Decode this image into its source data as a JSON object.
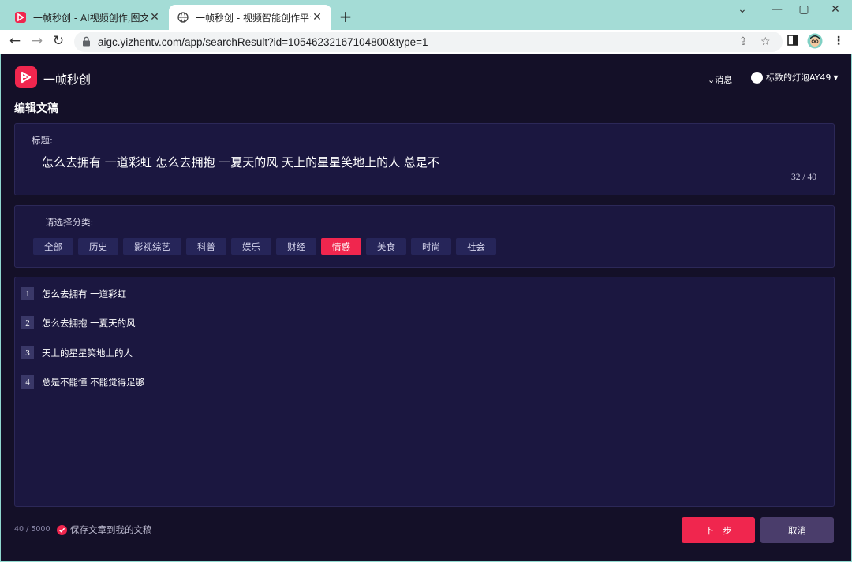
{
  "browser": {
    "tabs": [
      {
        "title": "一帧秒创 - AI视频创作,图文转视",
        "active": false
      },
      {
        "title": "一帧秒创 - 视频智能创作平台 - A",
        "active": true
      }
    ],
    "url": "aigc.yizhentv.com/app/searchResult?id=10546232167104800&type=1"
  },
  "header": {
    "brand": "一帧秒创",
    "messages_label": "消息",
    "username": "标致的灯泡AY49"
  },
  "page": {
    "title": "编辑文稿"
  },
  "title_panel": {
    "label": "标题:",
    "value": "怎么去拥有 一道彩虹 怎么去拥抱 一夏天的风 天上的星星笑地上的人 总是不",
    "counter": "32 / 40"
  },
  "category_panel": {
    "label": "请选择分类:",
    "categories": [
      "全部",
      "历史",
      "影视综艺",
      "科普",
      "娱乐",
      "财经",
      "情感",
      "美食",
      "时尚",
      "社会"
    ],
    "selected": "情感"
  },
  "lines": [
    {
      "num": "1",
      "text": "怎么去拥有 一道彩虹"
    },
    {
      "num": "2",
      "text": "怎么去拥抱 一夏天的风"
    },
    {
      "num": "3",
      "text": "天上的星星笑地上的人"
    },
    {
      "num": "4",
      "text": "总是不能懂 不能觉得足够"
    }
  ],
  "footer": {
    "char_count": "40 / 5000",
    "save_label": "保存文章到我的文稿",
    "next_label": "下一步",
    "cancel_label": "取消"
  },
  "colors": {
    "accent": "#f0264e",
    "background": "#141028",
    "panel": "#1b1740",
    "chip": "#262559",
    "cancel": "#4a3d6b"
  }
}
